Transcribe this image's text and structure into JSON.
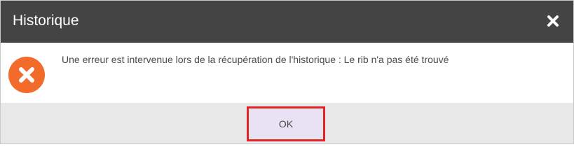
{
  "dialog": {
    "title": "Historique",
    "close_icon": "close-icon",
    "error_icon": "error-x-icon",
    "message": "Une erreur est intervenue lors de la récupération de l'historique : Le rib n'a pas été trouvé",
    "ok_label": "OK"
  },
  "colors": {
    "titlebar": "#444444",
    "error_icon": "#f26b2b",
    "footer": "#e8e8e8",
    "ok_button": "#e9e2f5",
    "highlight_outline": "#e2232a"
  }
}
